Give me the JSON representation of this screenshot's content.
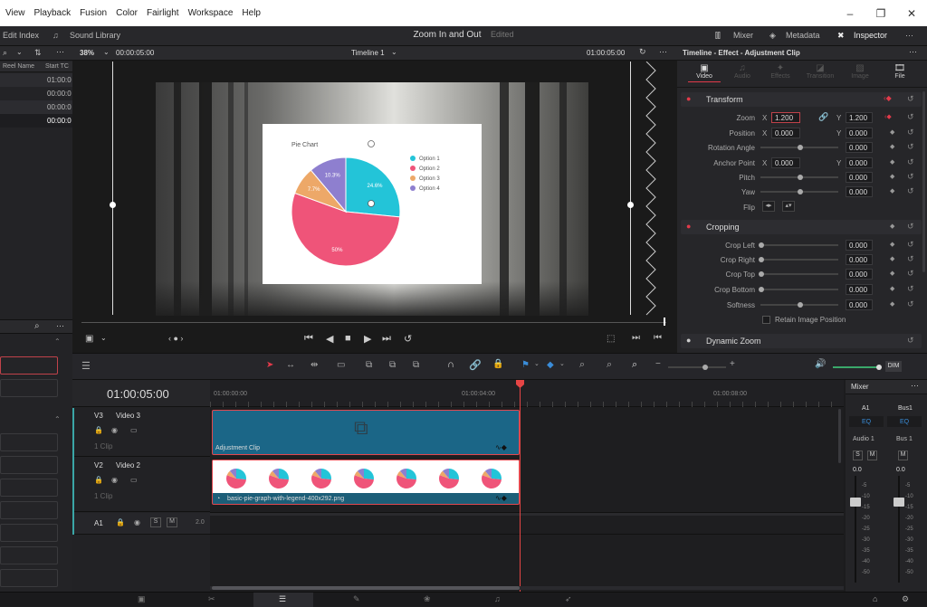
{
  "menu": [
    "View",
    "Playback",
    "Fusion",
    "Color",
    "Fairlight",
    "Workspace",
    "Help"
  ],
  "toolbar": {
    "edit_index": "Edit Index",
    "sound_library": "Sound Library",
    "project_name": "Zoom In and Out",
    "project_status": "Edited",
    "mixer": "Mixer",
    "metadata": "Metadata",
    "inspector": "Inspector"
  },
  "media_pool": {
    "col_reel": "Reel Name",
    "col_start": "Start TC",
    "rows": [
      "01:00:0",
      "00:00:0",
      "00:00:0",
      "00:00:0"
    ]
  },
  "viewer": {
    "zoom": "38%",
    "source_tc": "00:00:05:00",
    "timeline_name": "Timeline 1",
    "record_tc": "01:00:05:00",
    "pie_title": "Pie Chart",
    "legend": [
      "Option 1",
      "Option 2",
      "Option 3",
      "Option 4"
    ],
    "slice_labels": [
      "24.6%",
      "50%",
      "7.7%",
      "10.3%"
    ]
  },
  "chart_data": {
    "type": "pie",
    "title": "Pie Chart",
    "categories": [
      "Option 1",
      "Option 2",
      "Option 3",
      "Option 4"
    ],
    "values": [
      24.6,
      50,
      7.7,
      10.3
    ],
    "colors": [
      "#23c4d8",
      "#ef5479",
      "#eda868",
      "#8e7fcf"
    ],
    "legend": "top-right"
  },
  "inspector": {
    "title": "Timeline - Effect - Adjustment Clip",
    "tabs": [
      "Video",
      "Audio",
      "Effects",
      "Transition",
      "Image",
      "File"
    ],
    "transform_title": "Transform",
    "zoom_label": "Zoom",
    "zoom_x": "1.200",
    "zoom_y": "1.200",
    "position_label": "Position",
    "pos_x": "0.000",
    "pos_y": "0.000",
    "rotation_label": "Rotation Angle",
    "rotation": "0.000",
    "anchor_label": "Anchor Point",
    "anchor_x": "0.000",
    "anchor_y": "0.000",
    "pitch_label": "Pitch",
    "pitch": "0.000",
    "yaw_label": "Yaw",
    "yaw": "0.000",
    "flip_label": "Flip",
    "x_axis": "X",
    "y_axis": "Y",
    "cropping_title": "Cropping",
    "crop_left_label": "Crop Left",
    "crop_left": "0.000",
    "crop_right_label": "Crop Right",
    "crop_right": "0.000",
    "crop_top_label": "Crop Top",
    "crop_top": "0.000",
    "crop_bottom_label": "Crop Bottom",
    "crop_bottom": "0.000",
    "softness_label": "Softness",
    "softness": "0.000",
    "retain_label": "Retain Image Position",
    "dynamic_zoom_title": "Dynamic Zoom"
  },
  "timeline": {
    "timecode": "01:00:05:00",
    "ruler": [
      "01:00:00:00",
      "01:00:04:00",
      "01:00:08:00"
    ],
    "tracks": [
      {
        "id": "V3",
        "name": "Video 3",
        "clips": "1 Clip"
      },
      {
        "id": "V2",
        "name": "Video 2",
        "clips": "1 Clip"
      },
      {
        "id": "A1",
        "name": "",
        "level": "2.0"
      }
    ],
    "adjustment_clip": "Adjustment Clip",
    "image_clip": "basic-pie-graph-with-legend-400x292.png",
    "track_buttons": {
      "solo": "S",
      "mute": "M"
    }
  },
  "mixer": {
    "title": "Mixer",
    "ch1": "A1",
    "ch2": "Bus1",
    "eq": "EQ",
    "audio1": "Audio 1",
    "bus1": "Bus 1",
    "solo": "S",
    "mute": "M",
    "level1": "0.0",
    "level2": "0.0",
    "scale": [
      "-5",
      "-10",
      "-15",
      "-20",
      "-25",
      "-30",
      "-35",
      "-40",
      "-50"
    ],
    "dim": "DIM"
  },
  "colors": {
    "clip_blue": "#1b6687",
    "clip_selected_border": "#e0484f",
    "playhead": "#e54545",
    "accent_red": "#e23a4a"
  }
}
